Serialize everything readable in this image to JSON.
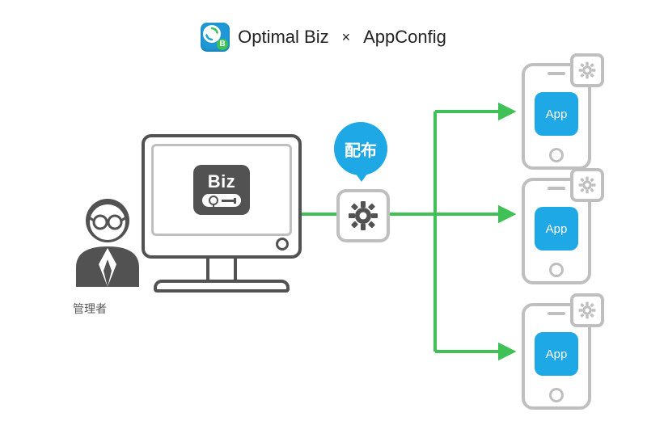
{
  "header": {
    "product_a": "Optimal Biz",
    "separator": "×",
    "product_b": "AppConfig",
    "logo_badge_letter": "B"
  },
  "admin": {
    "label": "管理者"
  },
  "monitor_app": {
    "title": "Biz"
  },
  "distribute": {
    "label": "配布"
  },
  "device_app": {
    "label": "App"
  },
  "icons": {
    "gear": "gear-icon",
    "arrow": "arrow-icon",
    "phone": "phone-icon",
    "person": "admin-person-icon",
    "recycle": "refresh-arrows-icon"
  },
  "colors": {
    "accent_blue": "#1fa8e6",
    "flow_green": "#3fc156",
    "outline_gray": "#bfbfbf",
    "dark_gray": "#525252"
  }
}
